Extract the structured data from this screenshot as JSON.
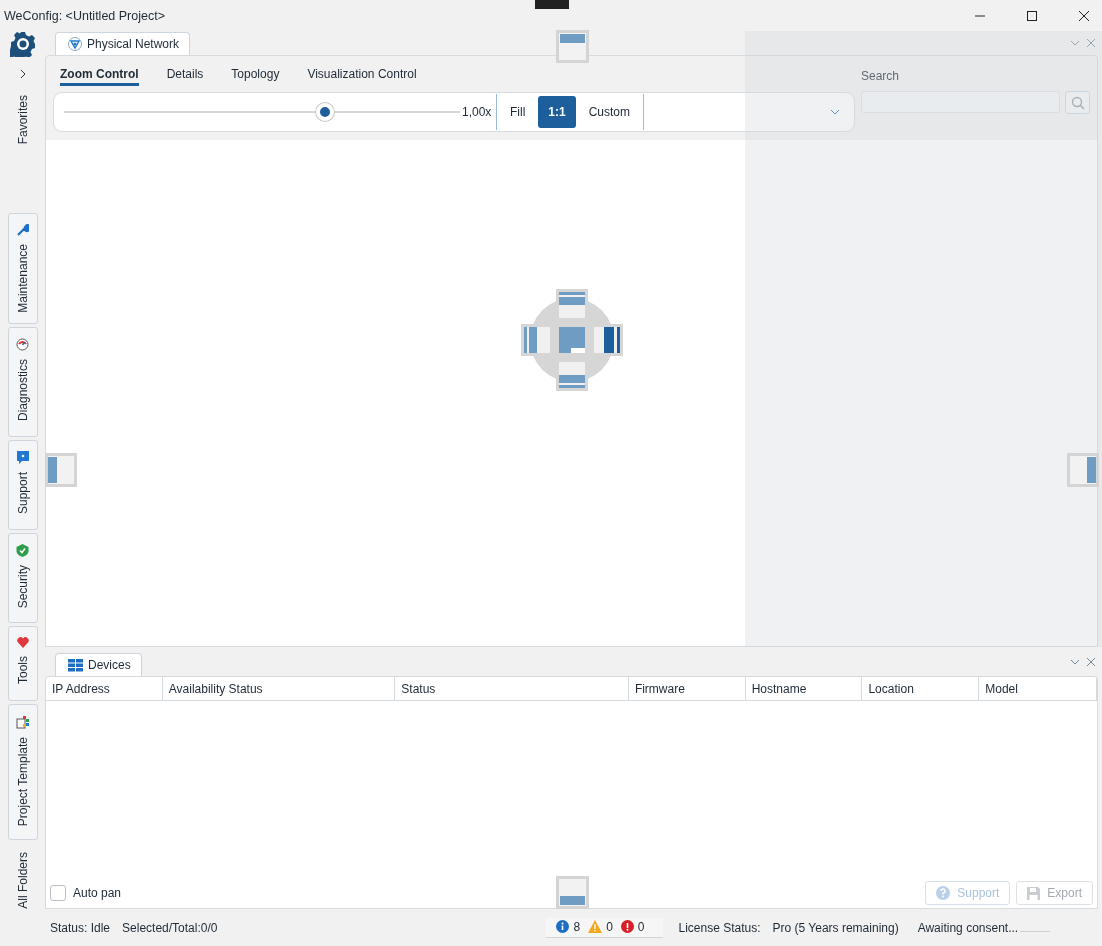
{
  "window": {
    "title": "WeConfig: <Untitled Project>"
  },
  "sidebar": {
    "favorites": "Favorites",
    "tabs": [
      {
        "label": "Maintenance"
      },
      {
        "label": "Diagnostics"
      },
      {
        "label": "Support"
      },
      {
        "label": "Security"
      },
      {
        "label": "Tools"
      },
      {
        "label": "Project Template"
      }
    ],
    "all_folders": "All Folders"
  },
  "document_tab": {
    "label": "Physical Network"
  },
  "ribbon_tabs": [
    {
      "label": "Zoom Control",
      "selected": true
    },
    {
      "label": "Details",
      "selected": false
    },
    {
      "label": "Topology",
      "selected": false
    },
    {
      "label": "Visualization Control",
      "selected": false
    }
  ],
  "zoom": {
    "level": 0.66,
    "reading": "1,00x",
    "modes": [
      {
        "label": "Fill",
        "selected": false
      },
      {
        "label": "1:1",
        "selected": true
      },
      {
        "label": "Custom",
        "selected": false
      }
    ]
  },
  "search": {
    "label": "Search"
  },
  "devices_tab": {
    "label": "Devices"
  },
  "table": {
    "columns": [
      "IP Address",
      "Availability Status",
      "Status",
      "Firmware",
      "Hostname",
      "Location",
      "Model"
    ]
  },
  "auto_pan": {
    "label": "Auto pan",
    "checked": false
  },
  "buttons": [
    {
      "label": "Support",
      "disabled": true
    },
    {
      "label": "Export",
      "disabled": true
    }
  ],
  "status_bar": {
    "status": "Status: Idle",
    "selected_total": "Selected/Total:0/0",
    "info_count": "8",
    "warning_count": "0",
    "error_count": "0",
    "license_label": "License Status:",
    "license_value": "Pro (5 Years remaining)",
    "consent": "Awaiting consent..."
  }
}
